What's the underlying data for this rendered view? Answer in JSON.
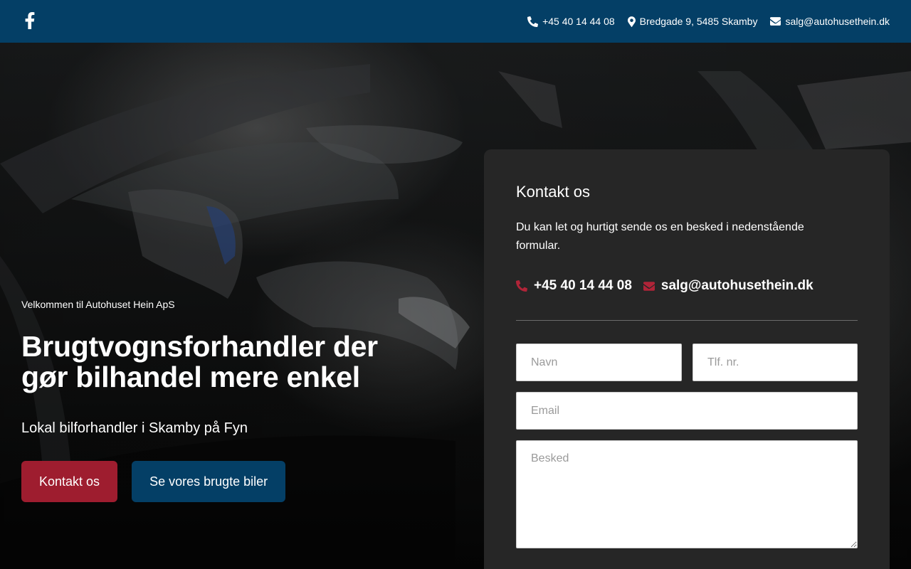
{
  "topbar": {
    "social": {
      "icon": "facebook-icon"
    },
    "contacts": [
      {
        "icon": "phone-icon",
        "text": "+45 40 14 44 08"
      },
      {
        "icon": "map-marker-icon",
        "text": "Bredgade 9, 5485 Skamby"
      },
      {
        "icon": "envelope-icon",
        "text": "salg@autohusethein.dk"
      }
    ]
  },
  "hero": {
    "eyebrow": "Velkommen til Autohuset Hein ApS",
    "headline_line1": "Brugtvognsforhandler der",
    "headline_line2": "gør bilhandel mere enkel",
    "subheadline": "Lokal bilforhandler i Skamby på Fyn",
    "buttons": {
      "primary": "Kontakt os",
      "secondary": "Se vores brugte biler"
    }
  },
  "contact_card": {
    "title": "Kontakt os",
    "intro": "Du kan let og hurtigt sende os en besked i nedenstående formular.",
    "phone": "+45 40 14 44 08",
    "email": "salg@autohusethein.dk",
    "form": {
      "name_placeholder": "Navn",
      "phone_placeholder": "Tlf. nr.",
      "email_placeholder": "Email",
      "message_placeholder": "Besked"
    }
  },
  "colors": {
    "topbar": "#043f66",
    "primary_button": "#9e1d2f",
    "secondary_button": "#043f66",
    "card": "#262626",
    "accent_icon": "#b02438"
  }
}
